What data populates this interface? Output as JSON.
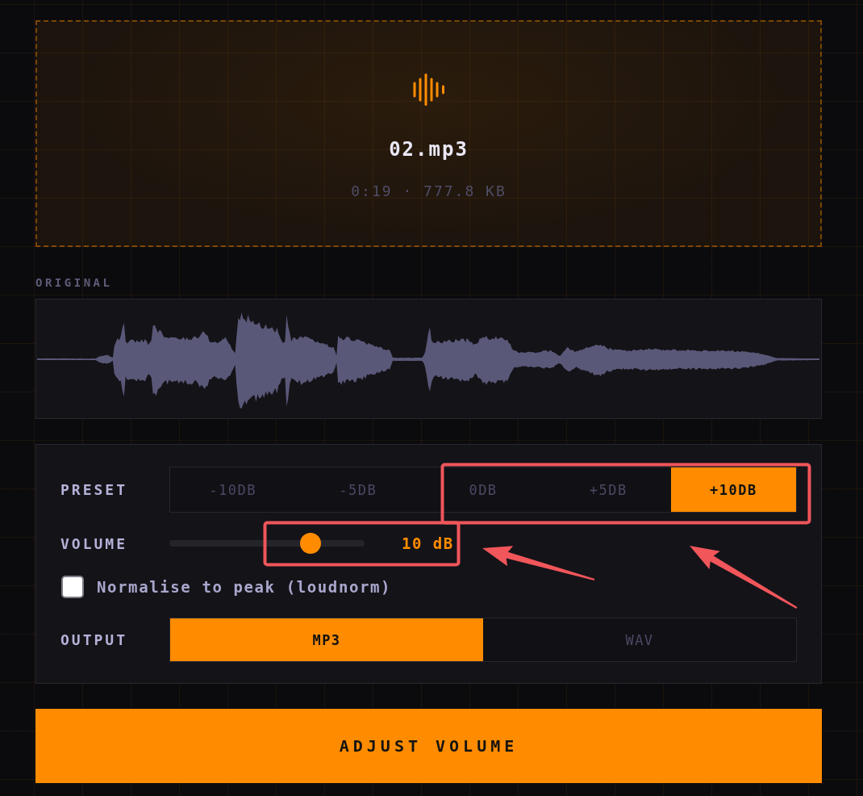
{
  "dropzone": {
    "filename": "02.mp3",
    "meta": "0:19 · 777.8 KB"
  },
  "waveform": {
    "label": "ORIGINAL"
  },
  "controls": {
    "preset": {
      "label": "PRESET",
      "options": [
        {
          "label": "-10DB",
          "selected": false
        },
        {
          "label": "-5DB",
          "selected": false
        },
        {
          "label": "0DB",
          "selected": false
        },
        {
          "label": "+5DB",
          "selected": false
        },
        {
          "label": "+10DB",
          "selected": true
        }
      ]
    },
    "volume": {
      "label": "VOLUME",
      "level": 0.75,
      "reading": "10 dB"
    },
    "normalise": {
      "label": "Normalise to peak (loudnorm)",
      "checked": false
    },
    "output": {
      "label": "OUTPUT",
      "options": [
        {
          "label": "MP3",
          "selected": true
        },
        {
          "label": "WAV",
          "selected": false
        }
      ]
    }
  },
  "action_button": {
    "label": "ADJUST VOLUME"
  }
}
